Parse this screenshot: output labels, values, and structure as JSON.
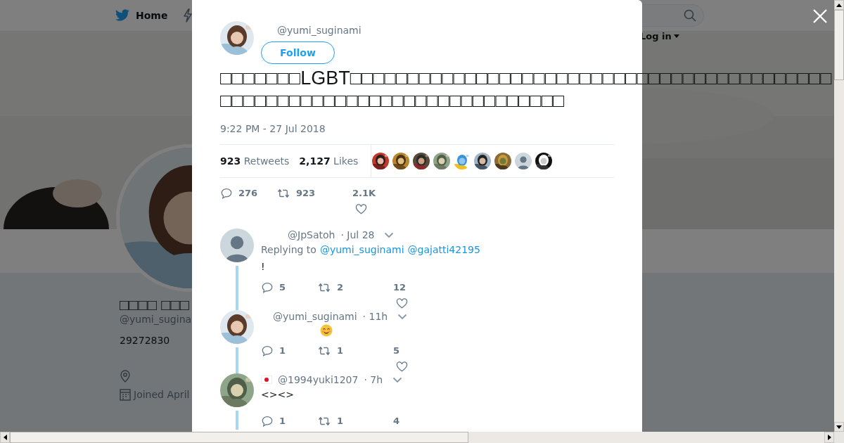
{
  "nav": {
    "home": "Home",
    "login": "Log in"
  },
  "profile": {
    "name": "□□□□ □□□",
    "handle": "@yumi_sugina",
    "bio": "29272830",
    "joined": "Joined April"
  },
  "tweet": {
    "handle": "@yumi_suginami",
    "follow": "Follow",
    "text": "□□□□□□□LGBT□□□□□□□□□□□□□□□□□□□□□□□□□□□□□□□□□□□□□□□□□□□□□□□□□□□□□□□□□□□□□□□□□□□□□□□□",
    "time": "9:22 PM - 27 Jul 2018",
    "retweet_count": "923",
    "retweet_label": "Retweets",
    "like_count": "2,127",
    "like_label": "Likes",
    "replies": "276",
    "retweets": "923",
    "likes": "2.1K"
  },
  "likers": [
    {
      "kind": "picture"
    },
    {
      "kind": "picture"
    },
    {
      "kind": "picture"
    },
    {
      "kind": "picture"
    },
    {
      "kind": "picture"
    },
    {
      "kind": "picture"
    },
    {
      "kind": "picture"
    },
    {
      "kind": "default"
    },
    {
      "kind": "picture"
    }
  ],
  "replies": [
    {
      "avatar": {
        "kind": "default"
      },
      "flag": false,
      "handle": "@JpSatoh",
      "time": "· Jul 28",
      "replying_to": "Replying to",
      "mentions": [
        "@yumi_suginami",
        "@gajatti42195"
      ],
      "text": "!",
      "emoji": false,
      "replies": "5",
      "retweets": "2",
      "likes": "12"
    },
    {
      "avatar": {
        "kind": "picture"
      },
      "flag": false,
      "handle": "@yumi_suginami",
      "time": "· 11h",
      "emoji": true,
      "replies": "1",
      "retweets": "1",
      "likes": "5"
    },
    {
      "avatar": {
        "kind": "picture"
      },
      "flag": true,
      "handle": "@1994yuki1207",
      "time": "· 7h",
      "text": "<><>",
      "emoji": false,
      "replies": "1",
      "retweets": "1",
      "likes": "4"
    }
  ]
}
